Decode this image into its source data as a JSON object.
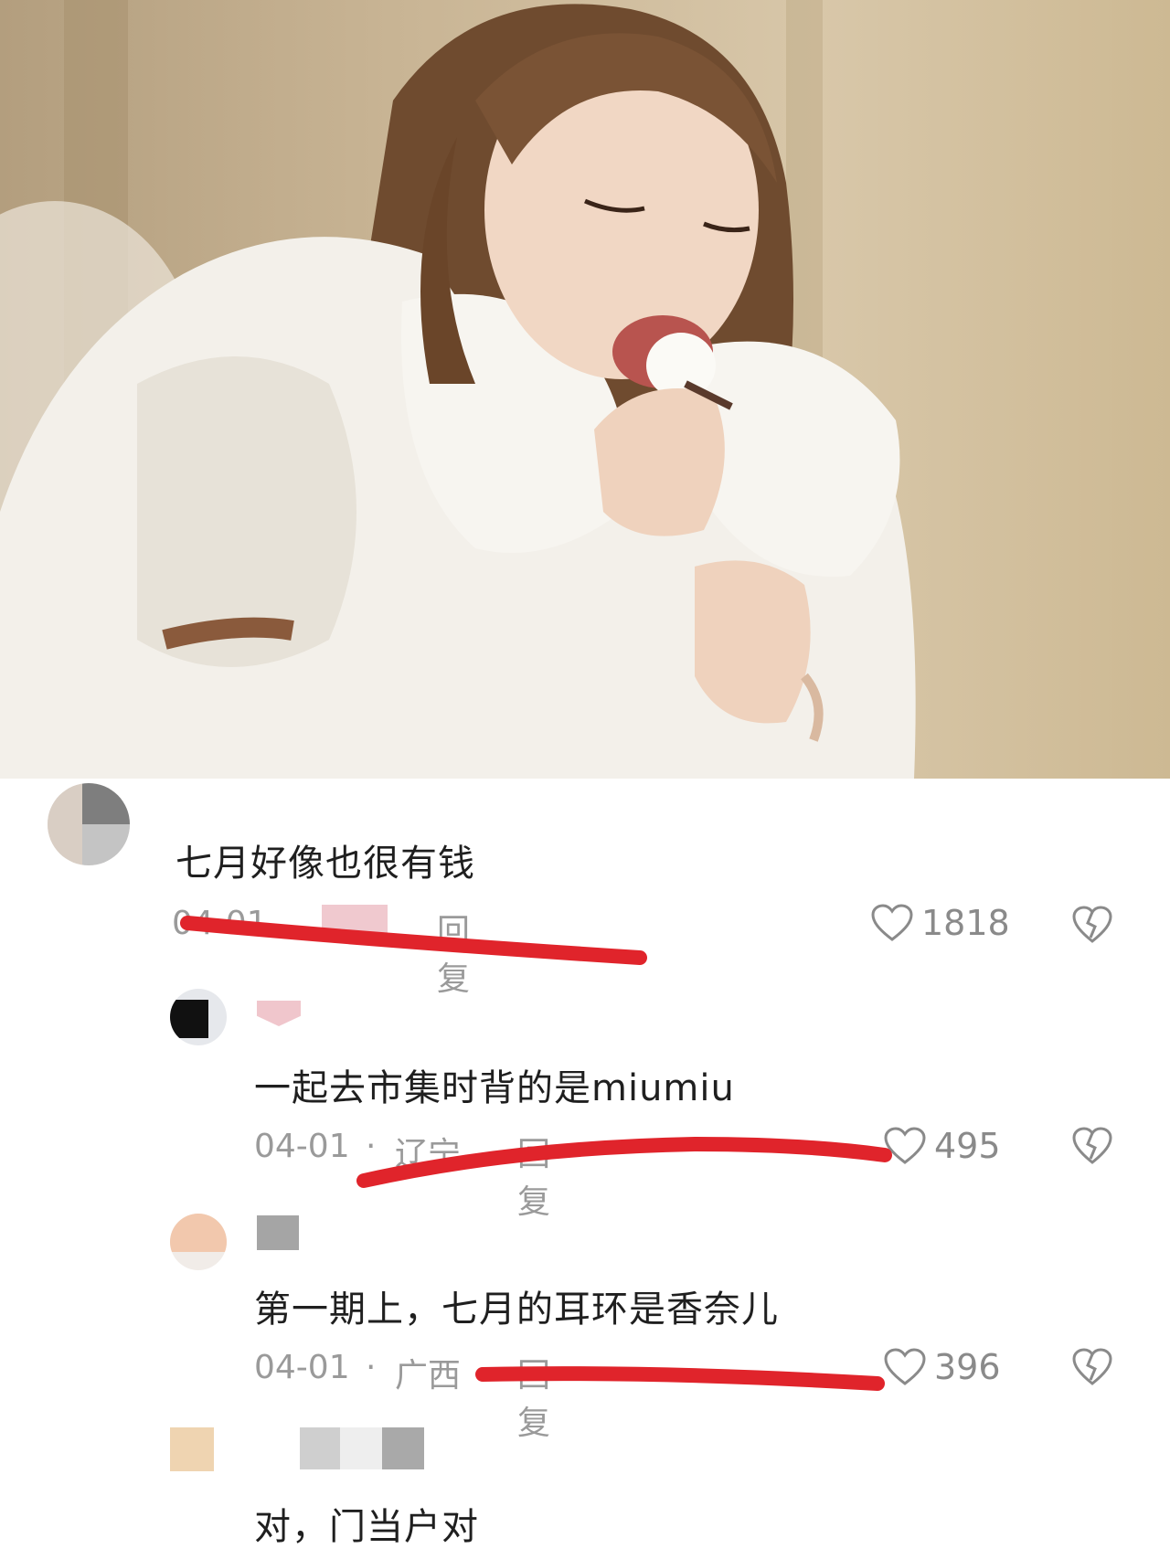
{
  "comments": [
    {
      "text": "七月好像也很有钱",
      "date": "04-01",
      "reply_label": "回复",
      "likes": "1818"
    },
    {
      "text": "一起去市集时背的是miumiu",
      "date": "04-01",
      "location": "辽宁",
      "separator": "·",
      "reply_label": "回复",
      "likes": "495"
    },
    {
      "text": "第一期上，七月的耳环是香奈儿",
      "date": "04-01",
      "location": "广西",
      "separator": "·",
      "reply_label": "回复",
      "likes": "396"
    },
    {
      "text": "对，门当户对"
    }
  ],
  "icons": {
    "like": "heart-outline-icon",
    "dislike": "broken-heart-icon"
  },
  "colors": {
    "annotation_red": "#e0242b",
    "meta_gray": "#9a9a9a",
    "text_dark": "#1f1f1f"
  }
}
